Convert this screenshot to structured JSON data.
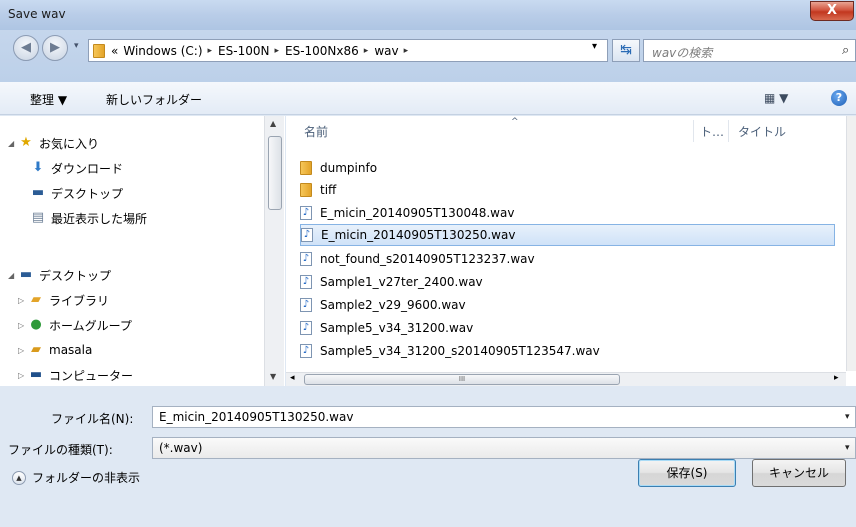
{
  "window": {
    "title": "Save wav",
    "close_glyph": "X"
  },
  "address": {
    "prefix": "«",
    "crumbs": [
      "Windows (C:)",
      "ES-100N",
      "ES-100Nx86",
      "wav"
    ],
    "separator": "▸",
    "dropdown": "▾",
    "refresh": "↹",
    "search_placeholder": "wavの検索",
    "search_icon": "⌕"
  },
  "toolbar": {
    "organize": "整理 ▼",
    "new_folder": "新しいフォルダー",
    "view": "▦ ▼",
    "help": "?"
  },
  "nav": {
    "items": [
      {
        "label": "お気に入り",
        "icon": "star-icon",
        "glyph": "★",
        "color": "#e0a800",
        "arrow": "◢"
      },
      {
        "label": "ダウンロード",
        "icon": "download-icon",
        "glyph": "⬇",
        "color": "#2f7ac8",
        "arrow": ""
      },
      {
        "label": "デスクトップ",
        "icon": "desktop-icon",
        "glyph": "▬",
        "color": "#2b5c95",
        "arrow": ""
      },
      {
        "label": "最近表示した場所",
        "icon": "recent-places-icon",
        "glyph": "▤",
        "color": "#6d7f96",
        "arrow": ""
      },
      {
        "label": "デスクトップ",
        "icon": "desktop-icon",
        "glyph": "▬",
        "color": "#2b5c95",
        "arrow": "◢"
      },
      {
        "label": "ライブラリ",
        "icon": "library-icon",
        "glyph": "▰",
        "color": "#e3a429",
        "arrow": "▷"
      },
      {
        "label": "ホームグループ",
        "icon": "homegroup-icon",
        "glyph": "●",
        "color": "#2f9a3a",
        "arrow": "▷"
      },
      {
        "label": "masala",
        "icon": "user-folder-icon",
        "glyph": "▰",
        "color": "#d99a1c",
        "arrow": "▷"
      },
      {
        "label": "コンピューター",
        "icon": "computer-icon",
        "glyph": "▬",
        "color": "#1f4f8a",
        "arrow": "▷"
      }
    ]
  },
  "columns": {
    "name": "名前",
    "track": "ト…",
    "title": "タイトル",
    "sort_indicator": "^"
  },
  "files": [
    {
      "name": "dumpinfo",
      "type": "folder"
    },
    {
      "name": "tiff",
      "type": "folder"
    },
    {
      "name": "E_micin_20140905T130048.wav",
      "type": "wav"
    },
    {
      "name": "E_micin_20140905T130250.wav",
      "type": "wav",
      "selected": true
    },
    {
      "name": "not_found_s20140905T123237.wav",
      "type": "wav"
    },
    {
      "name": "Sample1_v27ter_2400.wav",
      "type": "wav"
    },
    {
      "name": "Sample2_v29_9600.wav",
      "type": "wav"
    },
    {
      "name": "Sample5_v34_31200.wav",
      "type": "wav"
    },
    {
      "name": "Sample5_v34_31200_s20140905T123547.wav",
      "type": "wav"
    }
  ],
  "wav_glyph": "♪",
  "filename": {
    "label": "ファイル名(N):",
    "value": "E_micin_20140905T130250.wav"
  },
  "filetype": {
    "label": "ファイルの種類(T):",
    "value": "(*.wav)"
  },
  "hide_folders": "フォルダーの非表示",
  "buttons": {
    "save": "保存(S)",
    "cancel": "キャンセル"
  },
  "scrollbar": {
    "grip": "III",
    "up": "▲",
    "down": "▼",
    "left": "◂",
    "right": "▸"
  }
}
